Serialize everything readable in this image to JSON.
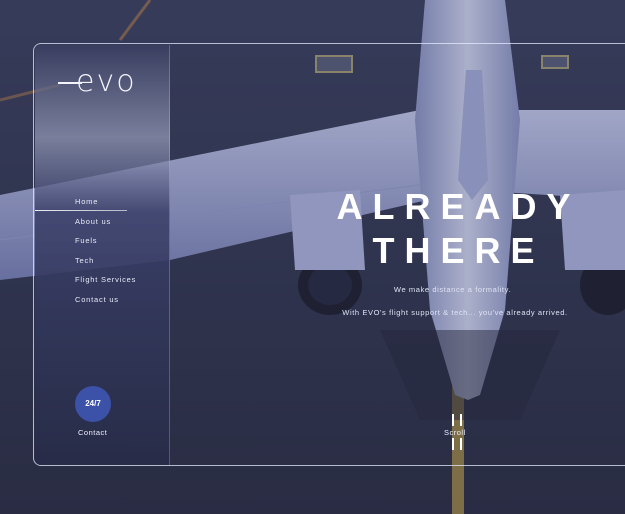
{
  "brand": {
    "logo_text": "evo"
  },
  "sidebar": {
    "nav": [
      {
        "label": "Home",
        "active": true
      },
      {
        "label": "About us"
      },
      {
        "label": "Fuels"
      },
      {
        "label": "Tech"
      },
      {
        "label": "Flight Services"
      },
      {
        "label": "Contact us"
      }
    ],
    "badge_label": "24/7",
    "contact_label": "Contact"
  },
  "hero": {
    "title_line1": "ALREADY",
    "title_line2": "THERE",
    "subtitle1": "We make distance a formality.",
    "subtitle2": "With EVO's flight support & tech... you've already arrived.",
    "scroll_label": "Scroll"
  },
  "colors": {
    "accent": "#3b52a8",
    "overlay": "#2b2f45",
    "frame": "#e6ebff"
  }
}
